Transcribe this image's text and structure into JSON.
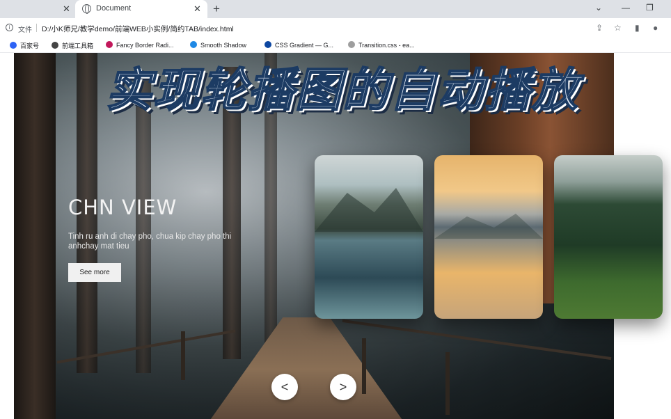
{
  "browser": {
    "active_tab_title": "Document",
    "file_label": "文件",
    "url": "D:/小K师兄/教学demo/前端WEB小实例/简约TAB/index.html"
  },
  "bookmarks": [
    {
      "label": "百家号",
      "icon_color": "#2d63f5"
    },
    {
      "label": "前端工具箱",
      "icon_color": "#444444"
    },
    {
      "label": "Fancy Border Radi...",
      "icon_color": "#c2185b"
    },
    {
      "label": "Smooth Shadow",
      "icon_color": "#1e88e5"
    },
    {
      "label": "CSS Gradient — G...",
      "icon_color": "#0d47a1"
    },
    {
      "label": "Transition.css - ea...",
      "icon_color": "#9e9e9e"
    }
  ],
  "overlay_title": "实现轮播图的自动播放",
  "hero": {
    "heading": "CHN VIEW",
    "description": "Tinh ru anh di chay pho, chua kip chay pho thi anhchay mat tieu",
    "button_label": "See more"
  },
  "carousel": {
    "prev_label": "<",
    "next_label": ">"
  }
}
